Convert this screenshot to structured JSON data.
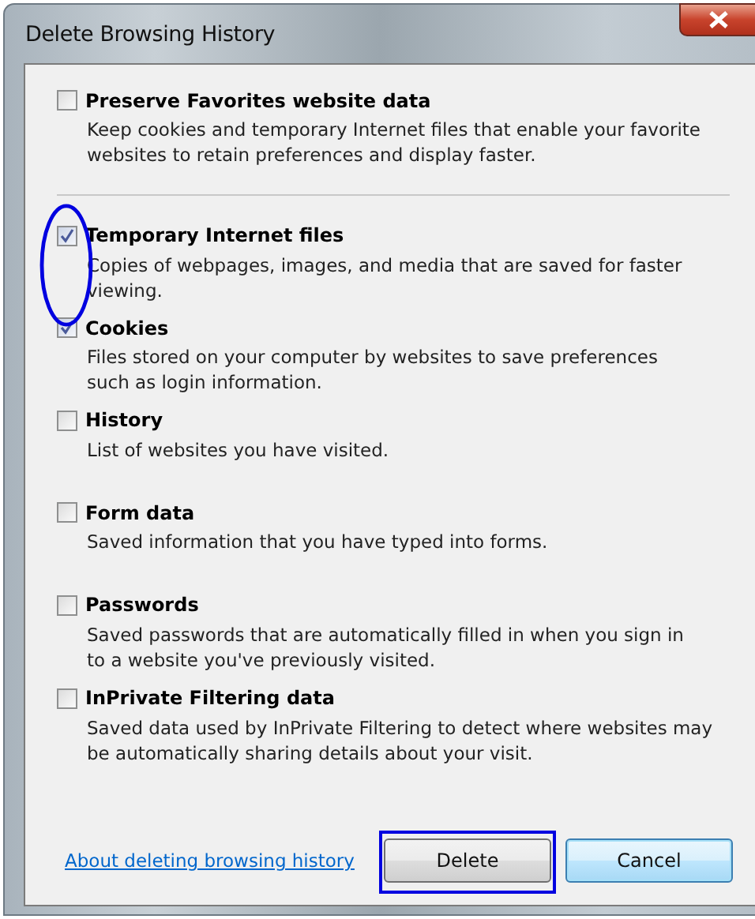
{
  "window": {
    "title": "Delete Browsing History"
  },
  "options": [
    {
      "label": "Preserve Favorites website data",
      "description": "Keep cookies and temporary Internet files that enable your favorite\nwebsites to retain preferences and display faster.",
      "checked": false,
      "separator_after": true
    },
    {
      "label": "Temporary Internet files",
      "description": "Copies of webpages, images, and media that are saved for faster\nviewing.",
      "checked": true,
      "separator_after": false
    },
    {
      "label": "Cookies",
      "description": "Files stored on your computer by websites to save preferences\nsuch as login information.",
      "checked": true,
      "separator_after": false
    },
    {
      "label": "History",
      "description": "List of websites you have visited.",
      "checked": false,
      "separator_after": false
    },
    {
      "label": "Form data",
      "description": "Saved information that you have typed into forms.",
      "checked": false,
      "separator_after": false
    },
    {
      "label": "Passwords",
      "description": "Saved passwords that are automatically filled in when you sign in\nto a website you've previously visited.",
      "checked": false,
      "separator_after": false
    },
    {
      "label": "InPrivate Filtering data",
      "description": "Saved data used by InPrivate Filtering to detect where websites may\nbe automatically sharing details about your visit.",
      "checked": false,
      "separator_after": false
    }
  ],
  "help_link": "About deleting browsing history",
  "buttons": [
    {
      "label": "Delete",
      "default": false
    },
    {
      "label": "Cancel",
      "default": true
    }
  ],
  "annotations": [
    {
      "kind": "ellipse"
    },
    {
      "kind": "rectangle"
    }
  ]
}
